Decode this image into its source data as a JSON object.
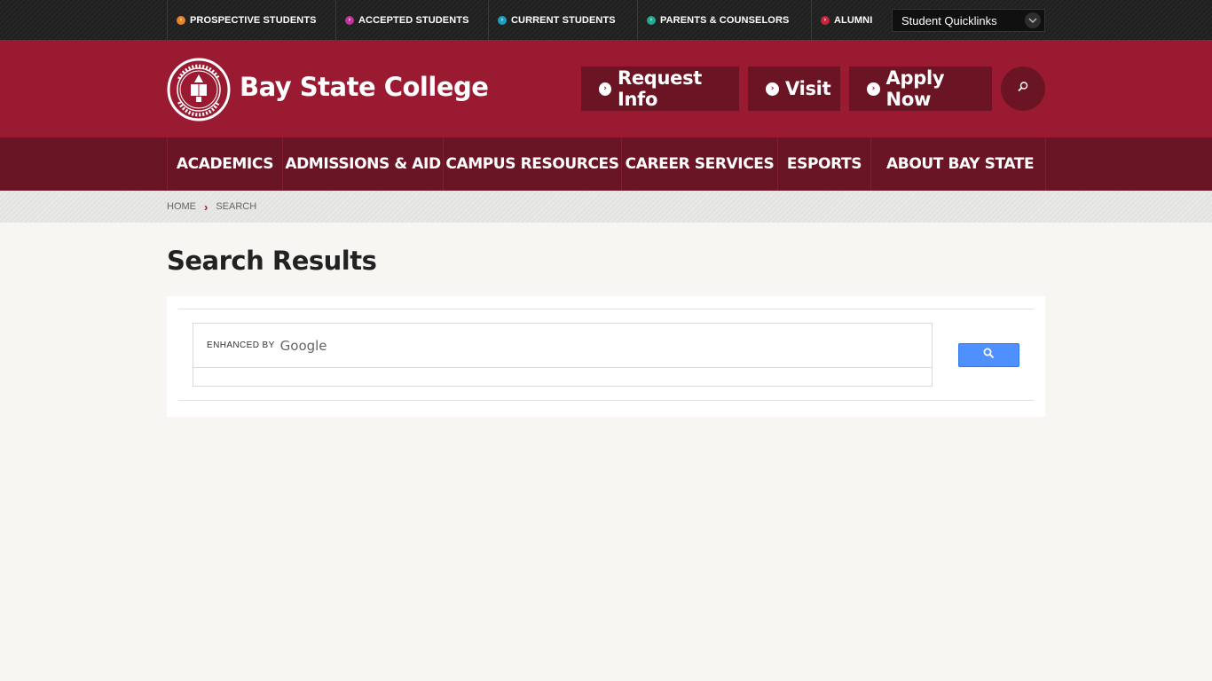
{
  "topbar": {
    "links": [
      {
        "label": "Prospective Students",
        "color": "#e8842a"
      },
      {
        "label": "Accepted Students",
        "color": "#c0349a"
      },
      {
        "label": "Current Students",
        "color": "#1a9fc0"
      },
      {
        "label": "Parents & Counselors",
        "color": "#23a98d"
      },
      {
        "label": "Alumni",
        "color": "#c8233f"
      }
    ],
    "quicklinks_label": "Student Quicklinks"
  },
  "header": {
    "logo_text": "Bay State College",
    "buttons": [
      {
        "label": "Request Info"
      },
      {
        "label": "Visit"
      },
      {
        "label": "Apply Now"
      }
    ]
  },
  "nav": {
    "items": [
      {
        "label": "ACADEMICS"
      },
      {
        "label": "ADMISSIONS & AID"
      },
      {
        "label": "CAMPUS RESOURCES"
      },
      {
        "label": "CAREER SERVICES"
      },
      {
        "label": "ESPORTS"
      },
      {
        "label": "ABOUT BAY STATE"
      }
    ]
  },
  "breadcrumb": {
    "home": "HOME",
    "current": "SEARCH"
  },
  "page": {
    "title": "Search Results"
  },
  "search": {
    "enhanced_by": "ENHANCED BY",
    "brand": "Google"
  },
  "colors": {
    "brand_red": "#9a1b31",
    "nav_dark": "#6a1525",
    "search_blue": "#4d90fe"
  }
}
